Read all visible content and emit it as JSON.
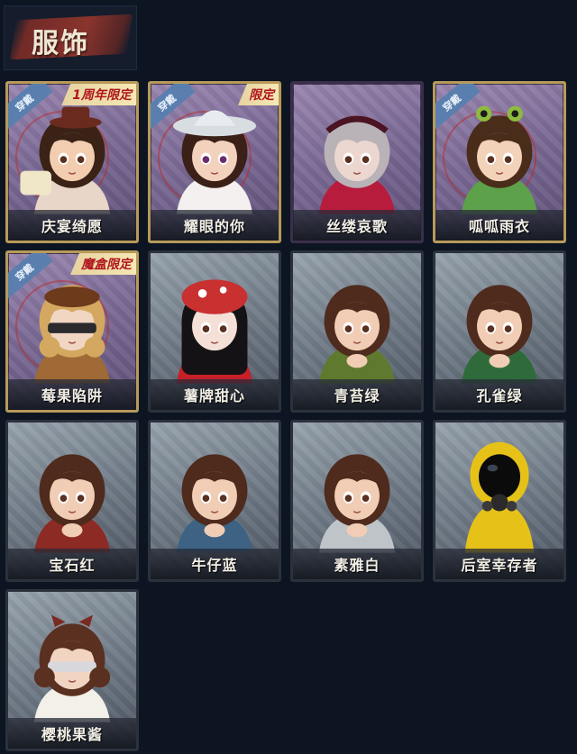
{
  "header": {
    "title": "服饰"
  },
  "badges": {
    "wear": "穿戴"
  },
  "colors": {
    "accent_gold": "#b79a5a",
    "limit_red": "#b0151e",
    "wear_blue": "#5a7fae"
  },
  "costumes": [
    {
      "name": "庆宴绮愿",
      "frame": "purple",
      "worn": true,
      "limit": "1周年限定",
      "icon": "cake-girl-icon"
    },
    {
      "name": "耀眼的你",
      "frame": "purple",
      "worn": true,
      "limit": "限定",
      "icon": "cowboy-hat-girl-icon"
    },
    {
      "name": "丝缕哀歌",
      "frame": "purple",
      "worn": false,
      "limit": "",
      "icon": "silver-hair-girl-icon"
    },
    {
      "name": "呱呱雨衣",
      "frame": "purple",
      "worn": true,
      "limit": "",
      "icon": "frog-hat-girl-icon"
    },
    {
      "name": "莓果陷阱",
      "frame": "purple",
      "worn": true,
      "limit": "魔盒限定",
      "icon": "berry-trap-girl-icon"
    },
    {
      "name": "薯牌甜心",
      "frame": "gray",
      "worn": false,
      "limit": "",
      "icon": "mushroom-hat-girl-icon"
    },
    {
      "name": "青苔绿",
      "frame": "gray",
      "worn": false,
      "limit": "",
      "icon": "green-coat-girl-icon"
    },
    {
      "name": "孔雀绿",
      "frame": "gray",
      "worn": false,
      "limit": "",
      "icon": "peacock-green-girl-icon"
    },
    {
      "name": "宝石红",
      "frame": "gray",
      "worn": false,
      "limit": "",
      "icon": "ruby-red-girl-icon"
    },
    {
      "name": "牛仔蓝",
      "frame": "gray",
      "worn": false,
      "limit": "",
      "icon": "denim-blue-girl-icon"
    },
    {
      "name": "素雅白",
      "frame": "gray",
      "worn": false,
      "limit": "",
      "icon": "plain-white-girl-icon"
    },
    {
      "name": "后室幸存者",
      "frame": "gray",
      "worn": false,
      "limit": "",
      "icon": "hazmat-survivor-icon"
    },
    {
      "name": "樱桃果酱",
      "frame": "gray",
      "worn": false,
      "limit": "",
      "icon": "blindfold-girl-icon"
    }
  ]
}
